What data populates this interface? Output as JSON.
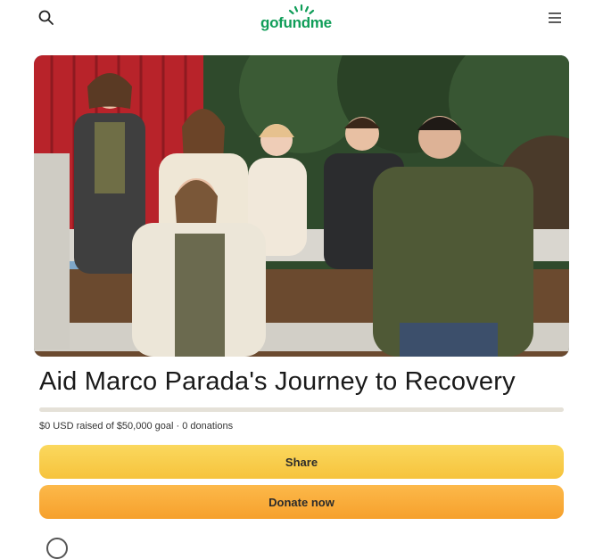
{
  "header": {
    "logo_text": "gofundme",
    "brand_color": "#0f9d58",
    "search_icon": "search-icon",
    "menu_icon": "hamburger-menu-icon"
  },
  "fundraiser": {
    "title": "Aid Marco Parada's Journey to Recovery",
    "stats": "$0 USD raised of $50,000 goal · 0 donations",
    "progress_fraction": 0,
    "progress_color": "#1f9c5c"
  },
  "actions": {
    "share_label": "Share",
    "donate_label": "Donate now"
  }
}
